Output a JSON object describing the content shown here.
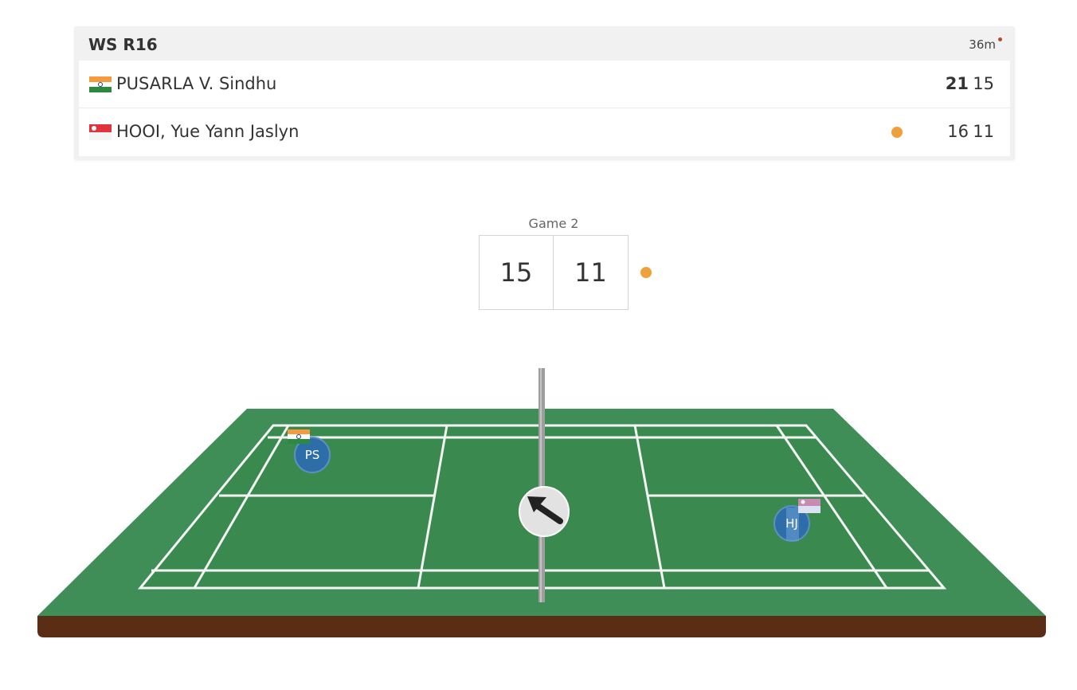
{
  "match": {
    "round": "WS R16",
    "duration": "36m",
    "live_indicator_color": "#b64a2c"
  },
  "players": [
    {
      "name": "PUSARLA V. Sindhu",
      "initials": "PS",
      "flag_icon": "india-flag-icon",
      "game_scores": [
        "21",
        "15"
      ],
      "won_game1": true,
      "serving": false
    },
    {
      "name": "HOOI, Yue Yann Jaslyn",
      "initials": "HJ",
      "flag_icon": "singapore-flag-icon",
      "game_scores": [
        "16",
        "11"
      ],
      "won_game1": false,
      "serving": true
    }
  ],
  "current_game": {
    "label": "Game 2",
    "score_left": "15",
    "score_right": "11",
    "serving_side": "right"
  },
  "colors": {
    "court_green": "#3f8d57",
    "court_inner": "#3a8a50",
    "court_base": "#5a2d14",
    "serve_dot": "#f0a03a",
    "player_token": "#2e6ea8",
    "header_bg": "#f1f1f1"
  },
  "shuttle_direction_icon": "arrow-up-left-icon"
}
